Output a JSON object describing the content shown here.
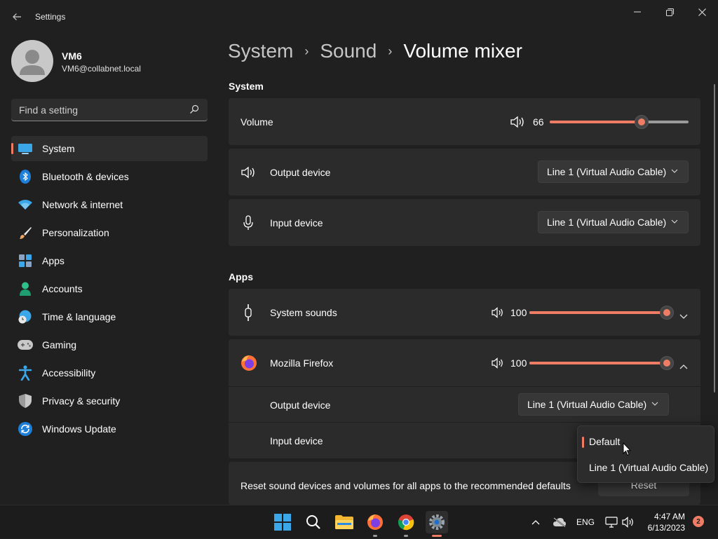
{
  "window": {
    "title": "Settings",
    "back_icon": "back-arrow-icon",
    "controls": [
      "minimize-icon",
      "maximize-icon",
      "close-icon"
    ]
  },
  "user": {
    "name": "VM6",
    "email": "VM6@collabnet.local"
  },
  "search": {
    "placeholder": "Find a setting"
  },
  "sidebar": {
    "items": [
      {
        "label": "System",
        "icon": "system-icon",
        "active": true
      },
      {
        "label": "Bluetooth & devices",
        "icon": "bluetooth-icon"
      },
      {
        "label": "Network & internet",
        "icon": "wifi-icon"
      },
      {
        "label": "Personalization",
        "icon": "brush-icon"
      },
      {
        "label": "Apps",
        "icon": "apps-icon"
      },
      {
        "label": "Accounts",
        "icon": "person-icon"
      },
      {
        "label": "Time & language",
        "icon": "globe-clock-icon"
      },
      {
        "label": "Gaming",
        "icon": "gamepad-icon"
      },
      {
        "label": "Accessibility",
        "icon": "accessibility-icon"
      },
      {
        "label": "Privacy & security",
        "icon": "shield-icon"
      },
      {
        "label": "Windows Update",
        "icon": "update-icon"
      }
    ]
  },
  "breadcrumb": {
    "items": [
      "System",
      "Sound",
      "Volume mixer"
    ],
    "separator": "›"
  },
  "system_section": {
    "title": "System",
    "volume": {
      "label": "Volume",
      "value": "66",
      "level": 0.66
    },
    "output_device": {
      "label": "Output device",
      "value": "Line 1 (Virtual Audio Cable)"
    },
    "input_device": {
      "label": "Input device",
      "value": "Line 1 (Virtual Audio Cable)"
    }
  },
  "apps_section": {
    "title": "Apps",
    "system_sounds": {
      "label": "System sounds",
      "value": "100",
      "level": 1.0
    },
    "firefox": {
      "label": "Mozilla Firefox",
      "value": "100",
      "level": 1.0,
      "output_device": {
        "label": "Output device",
        "value": "Line 1 (Virtual Audio Cable)"
      },
      "input_device": {
        "label": "Input device"
      }
    }
  },
  "input_dropdown": {
    "options": [
      "Default",
      "Line 1 (Virtual Audio Cable)"
    ],
    "selected": "Default"
  },
  "reset": {
    "text": "Reset sound devices and volumes for all apps to the recommended defaults",
    "button": "Reset"
  },
  "taskbar": {
    "apps": [
      "start-icon",
      "search-icon",
      "file-explorer-icon",
      "firefox-icon",
      "chrome-icon",
      "settings-icon"
    ],
    "language": "ENG",
    "time": "4:47 AM",
    "date": "6/13/2023",
    "notification_count": "2"
  },
  "colors": {
    "accent": "#ef7c64",
    "background": "#202020",
    "card": "#2b2b2b"
  }
}
